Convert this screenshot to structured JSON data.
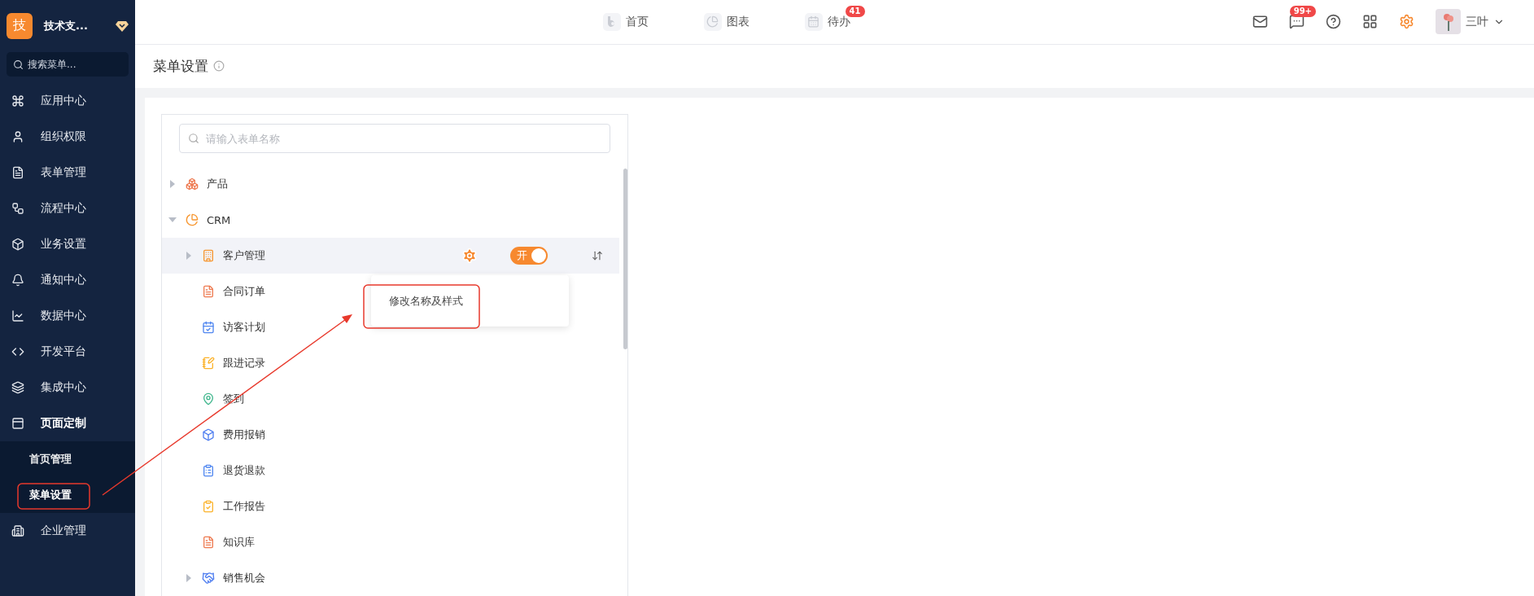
{
  "sidebar": {
    "brand": {
      "logo": "技",
      "name": "技术支..."
    },
    "search": {
      "placeholder": "搜索菜单..."
    },
    "items": [
      {
        "label": "应用中心",
        "selected": false
      },
      {
        "label": "组织权限",
        "selected": false
      },
      {
        "label": "表单管理",
        "selected": false
      },
      {
        "label": "流程中心",
        "selected": false
      },
      {
        "label": "业务设置",
        "selected": false
      },
      {
        "label": "通知中心",
        "selected": false
      },
      {
        "label": "数据中心",
        "selected": false
      },
      {
        "label": "开发平台",
        "selected": false
      },
      {
        "label": "集成中心",
        "selected": false
      },
      {
        "label": "页面定制",
        "selected": false,
        "expanded": true,
        "children": [
          {
            "label": "首页管理",
            "selected": false
          },
          {
            "label": "菜单设置",
            "selected": true
          }
        ]
      },
      {
        "label": "企业管理",
        "selected": false
      }
    ]
  },
  "topbar": {
    "nav": [
      {
        "label": "首页"
      },
      {
        "label": "图表"
      },
      {
        "label": "待办",
        "badge": "41"
      }
    ],
    "message_badge": "99+",
    "user": "三叶"
  },
  "page": {
    "title": "菜单设置"
  },
  "tree": {
    "search": {
      "placeholder": "请输入表单名称"
    },
    "nodes": [
      {
        "label": "产品",
        "expanded": false
      },
      {
        "label": "CRM",
        "expanded": true,
        "children": [
          {
            "label": "客户管理",
            "expanded": false,
            "selected": true,
            "toggle": {
              "label": "开",
              "on": true
            },
            "menu": {
              "item": "修改名称及样式"
            }
          },
          {
            "label": "合同订单",
            "selected": false
          },
          {
            "label": "访客计划",
            "selected": false
          },
          {
            "label": "跟进记录",
            "selected": false
          },
          {
            "label": "签到",
            "selected": false
          },
          {
            "label": "费用报销",
            "selected": false
          },
          {
            "label": "退货退款",
            "selected": false
          },
          {
            "label": "工作报告",
            "selected": false
          },
          {
            "label": "知识库",
            "selected": false
          },
          {
            "label": "销售机会",
            "expanded": false,
            "selected": false
          }
        ]
      }
    ]
  }
}
